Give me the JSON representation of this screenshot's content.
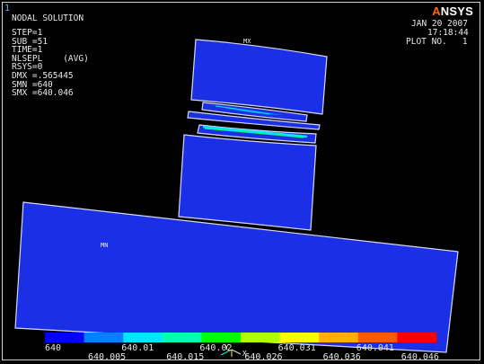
{
  "window_number": "1",
  "header_left": {
    "title": "NODAL SOLUTION",
    "lines": [
      "STEP=1",
      "SUB =51",
      "TIME=1",
      "NLSEPL    (AVG)",
      "RSYS=0",
      "DMX =.565445",
      "SMN =640",
      "SMX =640.046"
    ]
  },
  "header_right": {
    "date": "JAN 20 2007",
    "time": "17:18:44",
    "plot_no": "PLOT NO.   1"
  },
  "logo": {
    "prefix": "A",
    "rest": "NSYS"
  },
  "markers": {
    "max": "MX",
    "min": "MN"
  },
  "triad": {
    "x_axis": "X",
    "y_axis": "Y"
  },
  "legend": {
    "top_labels": [
      "640",
      "640.01",
      "640.02",
      "640.031",
      "640.041"
    ],
    "bottom_labels": [
      "640.005",
      "640.015",
      "640.026",
      "640.036",
      "640.046"
    ],
    "colors": [
      "#0000ff",
      "#0080ff",
      "#00e5ff",
      "#00ffb0",
      "#00ff00",
      "#b0ff00",
      "#ffff00",
      "#ffb000",
      "#ff5a00",
      "#ff0000"
    ]
  },
  "colors": {
    "background": "#000000",
    "body": "#1a2fe6",
    "text": "#e8e8e8"
  }
}
